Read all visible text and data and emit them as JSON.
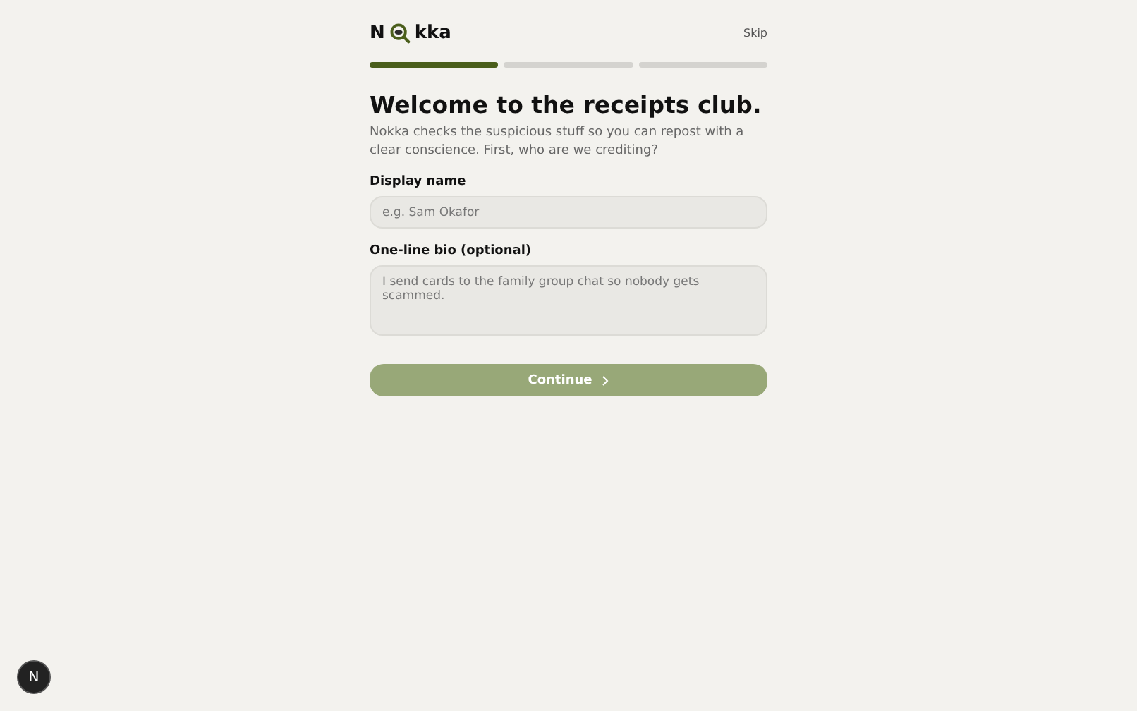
{
  "logo": {
    "before": "N",
    "after": "kka"
  },
  "skip": "Skip",
  "steps": [
    {
      "done": true
    },
    {
      "done": false
    },
    {
      "done": false
    }
  ],
  "title": "Welcome to the receipts club.",
  "intro": "Nokka checks the suspicious stuff so you can repost with a clear conscience. First, who are we crediting?",
  "fields": [
    {
      "kind": "input",
      "label": "Display name",
      "placeholder": "e.g. Sam Okafor"
    },
    {
      "kind": "textarea",
      "label": "One-line bio (optional)",
      "placeholder": "I send cards to the family group chat so nobody gets scammed."
    }
  ],
  "continue_button": {
    "label": "Continue",
    "disabled": true
  },
  "dev_badge": "N"
}
